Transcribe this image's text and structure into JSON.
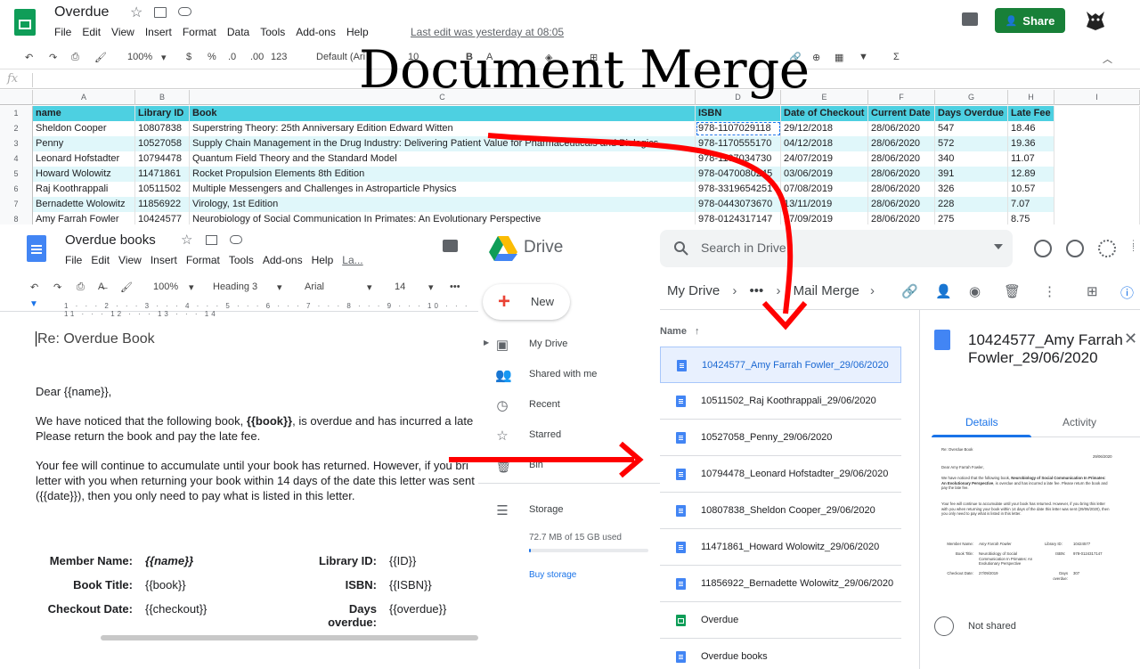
{
  "overlay": {
    "title": "Document Merge"
  },
  "sheets": {
    "title": "Overdue",
    "menu": [
      "File",
      "Edit",
      "View",
      "Insert",
      "Format",
      "Data",
      "Tools",
      "Add-ons",
      "Help"
    ],
    "last_edit": "Last edit was yesterday at 08:05",
    "share_label": "Share",
    "toolbar": {
      "zoom": "100%",
      "currency": "$",
      "percent": "%",
      "dec1": ".0",
      "dec2": ".00",
      "format": "123",
      "font": "Default (Ari",
      "size": "10"
    },
    "fx_label": "fx",
    "columns": [
      "A",
      "B",
      "C",
      "D",
      "E",
      "F",
      "G",
      "H",
      "I"
    ],
    "headers": [
      "name",
      "Library ID",
      "Book",
      "ISBN",
      "Date of Checkout",
      "Current Date",
      "Days Overdue",
      "Late Fee"
    ],
    "rows": [
      [
        "Sheldon Cooper",
        "10807838",
        "Superstring Theory: 25th Anniversary Edition Edward Witten",
        "978-1107029118",
        "29/12/2018",
        "28/06/2020",
        "547",
        "18.46"
      ],
      [
        "Penny",
        "10527058",
        "Supply Chain Management in the Drug Industry: Delivering Patient Value for Pharmaceuticals and Biologics",
        "978-1170555170",
        "04/12/2018",
        "28/06/2020",
        "572",
        "19.36"
      ],
      [
        "Leonard Hofstadter",
        "10794478",
        "Quantum Field Theory and the Standard Model",
        "978-1107034730",
        "24/07/2019",
        "28/06/2020",
        "340",
        "11.07"
      ],
      [
        "Howard Wolowitz",
        "11471861",
        "Rocket Propulsion Elements 8th Edition",
        "978-0470080245",
        "03/06/2019",
        "28/06/2020",
        "391",
        "12.89"
      ],
      [
        "Raj Koothrappali",
        "10511502",
        "Multiple Messengers and Challenges in Astroparticle Physics",
        "978-3319654251",
        "07/08/2019",
        "28/06/2020",
        "326",
        "10.57"
      ],
      [
        "Bernadette Wolowitz",
        "11856922",
        "Virology, 1st Edition",
        "978-0443073670",
        "13/11/2019",
        "28/06/2020",
        "228",
        "7.07"
      ],
      [
        "Amy Farrah Fowler",
        "10424577",
        "Neurobiology of Social Communication In Primates: An Evolutionary Perspective",
        "978-0124317147",
        "17/09/2019",
        "28/06/2020",
        "275",
        "8.75"
      ]
    ]
  },
  "docs": {
    "title": "Overdue books",
    "menu": [
      "File",
      "Edit",
      "View",
      "Insert",
      "Format",
      "Tools",
      "Add-ons",
      "Help",
      "La..."
    ],
    "toolbar": {
      "zoom": "100%",
      "style": "Heading 3",
      "font": "Arial",
      "size": "14"
    },
    "heading": "Re: Overdue Book",
    "greeting": "Dear {{name}},",
    "para1_pre": "We have noticed that the following book, ",
    "para1_book": "{{book}}",
    "para1_post": ", is overdue and has incurred a late",
    "para1_line2": "Please return the book and pay the late fee.",
    "para2_line1": "Your fee will continue to accumulate until your book has returned. However, if you bri",
    "para2_line2": "letter with you when returning your book within 14 days of the date this letter was sent",
    "para2_line3": "({{date}}), then you only need to pay what is listed in this letter.",
    "table": {
      "member_label": "Member Name:",
      "member_value": "{{name}}",
      "libid_label": "Library ID:",
      "libid_value": "{{ID}}",
      "book_label": "Book Title:",
      "book_value": "{{book}}",
      "isbn_label": "ISBN:",
      "isbn_value": "{{ISBN}}",
      "checkout_label": "Checkout Date:",
      "checkout_value": "{{checkout}}",
      "days_label1": "Days",
      "days_label2": "overdue:",
      "days_value": "{{overdue}}"
    }
  },
  "drive": {
    "title": "Drive",
    "search_placeholder": "Search in Drive",
    "new_label": "New",
    "nav": [
      "My Drive",
      "Shared with me",
      "Recent",
      "Starred",
      "Bin"
    ],
    "storage_label": "Storage",
    "storage_used": "72.7 MB of 15 GB used",
    "storage_fraction": 0.005,
    "buy_storage": "Buy storage",
    "breadcrumb": {
      "root": "My Drive",
      "more": "•••",
      "folder": "Mail Merge"
    },
    "column_name": "Name",
    "files": [
      {
        "name": "10424577_Amy Farrah Fowler_29/06/2020",
        "type": "doc",
        "selected": true
      },
      {
        "name": "10511502_Raj Koothrappali_29/06/2020",
        "type": "doc"
      },
      {
        "name": "10527058_Penny_29/06/2020",
        "type": "doc"
      },
      {
        "name": "10794478_Leonard Hofstadter_29/06/2020",
        "type": "doc"
      },
      {
        "name": "10807838_Sheldon Cooper_29/06/2020",
        "type": "doc"
      },
      {
        "name": "11471861_Howard Wolowitz_29/06/2020",
        "type": "doc"
      },
      {
        "name": "11856922_Bernadette Wolowitz_29/06/2020",
        "type": "doc"
      },
      {
        "name": "Overdue",
        "type": "sheet"
      },
      {
        "name": "Overdue books",
        "type": "doc"
      }
    ],
    "detail": {
      "title": "10424577_Amy Farrah Fowler_29/06/2020",
      "tab_details": "Details",
      "tab_activity": "Activity",
      "sharing": "Not shared",
      "preview": {
        "heading": "Re: Overdue Book",
        "date": "29/06/2020",
        "greeting": "Dear Amy Farrah Fowler,",
        "p1a": "We have noticed that the following book,",
        "p1b": "Neurobiology of Social Communication In Primates: An Evolutionary Perspective",
        "p1c": ", is overdue and has incurred a late fee. Please return the book and pay the late fee.",
        "p2": "Your fee will continue to accumulate until your book has returned. However, if you bring this letter with you when returning your book within 14 days of the date this letter was sent (29/06/2020), then you only need to pay what is listed in this letter.",
        "member_label": "Member Name:",
        "member_value": "Amy Farrah Fowler",
        "libid_label": "Library ID:",
        "libid_value": "10424577",
        "book_label": "Book Title:",
        "book_value": "Neurobiology of Social Communication In Primates: An Evolutionary Perspective",
        "isbn_label": "ISBN:",
        "isbn_value": "978-0124317147",
        "checkout_label": "Checkout Date:",
        "checkout_value": "27/09/2019",
        "days_label": "Days overdue:",
        "days_value": "307"
      }
    }
  },
  "colors": {
    "sheet_header": "#4dd0e1",
    "sheet_alt_row": "#e0f7fa",
    "share_button": "#188038",
    "drive_blue": "#1a73e8",
    "arrow_red": "#ff0000"
  }
}
